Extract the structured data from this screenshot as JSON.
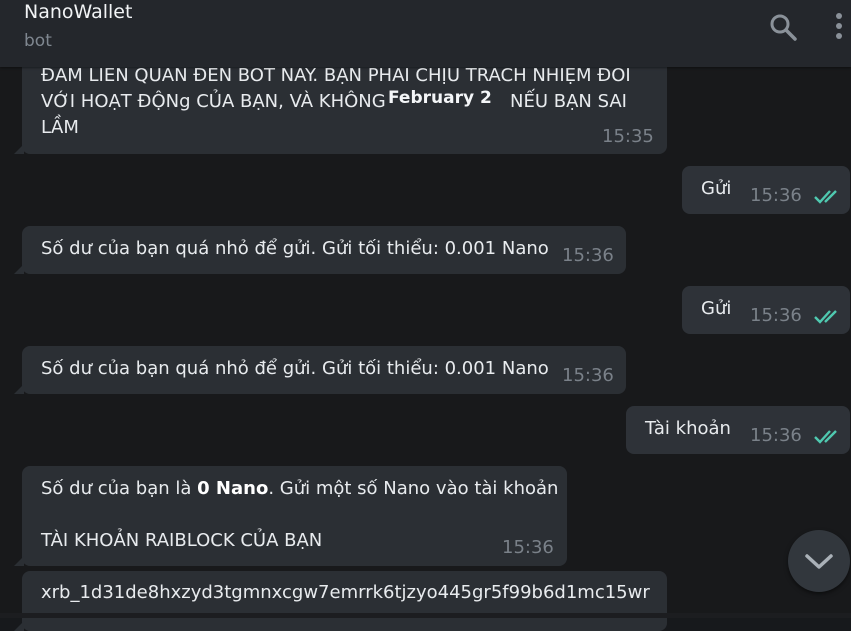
{
  "header": {
    "title": "NanoWallet",
    "subtitle": "bot",
    "icons": [
      "search-icon",
      "more-vertical-icon"
    ]
  },
  "date_separator": "February 2",
  "messages": [
    {
      "direction": "in",
      "lines": [
        "ĐẢM LIÊN QUAN ĐẾN BOT NÀY. BẠN PHẢI CHỊU TRÁCH NHIỆM ĐỐI",
        "VỚI HOẠT ĐỘNg CỦA BẠN, VÀ KHÔNG",
        "NẾU BẠN SAI",
        "LẦM"
      ],
      "time": "15:35"
    },
    {
      "direction": "out",
      "text": "Gửi",
      "time": "15:36"
    },
    {
      "direction": "in",
      "text": "Số dư của bạn quá nhỏ để gửi. Gửi tối thiểu: 0.001 Nano",
      "time": "15:36"
    },
    {
      "direction": "out",
      "text": "Gửi",
      "time": "15:36"
    },
    {
      "direction": "in",
      "text": "Số dư của bạn quá nhỏ để gửi. Gửi tối thiểu: 0.001 Nano",
      "time": "15:36"
    },
    {
      "direction": "out",
      "text": "Tài khoản",
      "time": "15:36"
    },
    {
      "direction": "in",
      "prefix": "Số dư của bạn là ",
      "balance": "0 Nano",
      "suffix": ". Gửi một số Nano vào tài khoản",
      "line2": "TÀI KHOẢN RAIBLOCK CỦA BẠN",
      "time": "15:36"
    },
    {
      "direction": "in",
      "text": "xrb_1d31de8hxzyd3tgmnxcgw7emrrk6tjzyo445gr5f99b6d1mc15wr"
    }
  ],
  "colors": {
    "background": "#18191b",
    "header": "#24272c",
    "bubble": "#2b2f34",
    "read_ticks": "#4fc9b0"
  },
  "scroll_button_icon": "chevron-down-icon"
}
